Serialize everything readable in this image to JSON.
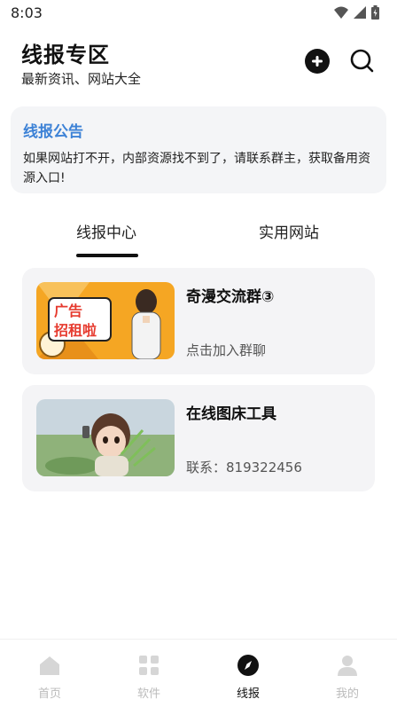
{
  "status_bar": {
    "time": "8:03",
    "icons": [
      "wifi-icon",
      "signal-icon",
      "battery-icon"
    ]
  },
  "header": {
    "title": "线报专区",
    "subtitle": "最新资讯、网站大全",
    "add_icon": "plus-circle-icon",
    "search_icon": "search-icon"
  },
  "notice": {
    "title": "线报公告",
    "text": "如果网站打不开，内部资源找不到了，请联系群主，获取备用资源入口!",
    "accent": "#3d82d6"
  },
  "tabs": [
    {
      "label": "线报中心",
      "active": true
    },
    {
      "label": "实用网站",
      "active": false
    }
  ],
  "cards": [
    {
      "title": "奇漫交流群③",
      "subtitle": "点击加入群聊",
      "thumb_text": "广告招租啦"
    },
    {
      "title": "在线图床工具",
      "subtitle": "联系：819322456"
    }
  ],
  "bottom_nav": [
    {
      "label": "首页",
      "icon": "home-icon",
      "active": false
    },
    {
      "label": "软件",
      "icon": "grid-icon",
      "active": false
    },
    {
      "label": "线报",
      "icon": "compass-icon",
      "active": true
    },
    {
      "label": "我的",
      "icon": "user-icon",
      "active": false
    }
  ]
}
